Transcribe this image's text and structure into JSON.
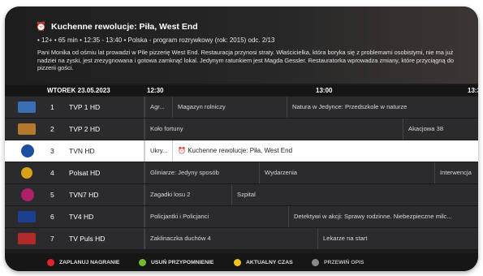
{
  "hero": {
    "clock_glyph": "⏰",
    "title": "Kuchenne rewolucje: Piła, West End",
    "meta": "•  12+  •  65 min  •  12:35 - 13:40  •  Polska - program rozrywkowy (rok: 2015) odc. 2/13",
    "description": "Pani Monika od ośmiu lat prowadzi w Pile pizzerię West End. Restauracja przynosi straty. Właścicielka, która boryka się z problemami osobistymi, nie ma już nadziei na zyski, jest zrezygnowana i gotowa zamknąć lokal. Jedynym ratunkiem jest Magda Gessler. Restauratorka wprowadza zmiany, które przyciągną do pizzerii gości."
  },
  "timebar": {
    "date": "WTOREK 23.05.2023",
    "t1": "12:30",
    "t2": "13:00",
    "t3": "13:3"
  },
  "channels": [
    {
      "num": "1",
      "name": "TVP 1 HD",
      "logo_color": "#3a6fb5",
      "programs": [
        "Agr...",
        "Magazyn rolniczy",
        "Natura w Jedynce: Przedszkole w naturze"
      ]
    },
    {
      "num": "2",
      "name": "TVP 2 HD",
      "logo_color": "#b4782e",
      "programs": [
        "Koło fortuny",
        "Akacjowa 38"
      ]
    },
    {
      "num": "3",
      "name": "TVN HD",
      "logo_color": "#1d4fa0",
      "programs": [
        "Ukry...",
        "Kuchenne rewolucje: Piła, West End"
      ]
    },
    {
      "num": "4",
      "name": "Polsat HD",
      "logo_color": "#d9a21a",
      "programs": [
        "Gliniarze: Jedyny sposób",
        "Wydarzenia",
        "Interwencja"
      ]
    },
    {
      "num": "5",
      "name": "TVN7 HD",
      "logo_color": "#b0206a",
      "programs": [
        "Zagadki losu 2",
        "Szpital"
      ]
    },
    {
      "num": "6",
      "name": "TV4 HD",
      "logo_color": "#1c3f8f",
      "programs": [
        "Policjantki i Policjanci",
        "Detektywi w akcji: Sprawy rodzinne. Niebezpieczne milc..."
      ]
    },
    {
      "num": "7",
      "name": "TV Puls HD",
      "logo_color": "#b02a2a",
      "programs": [
        "Zaklinaczka duchów 4",
        "Lekarze na start"
      ]
    }
  ],
  "footer": {
    "red_label": "ZAPLANUJ NAGRANIE",
    "red_color": "#e0242a",
    "green_label": "USUŃ PRZYPOMNIENIE",
    "green_color": "#6fbf2a",
    "yellow_label": "AKTUALNY CZAS",
    "yellow_color": "#f1c21b",
    "gray_label": "PRZEWIŃ OPIS",
    "gray_color": "#8a8a8a"
  }
}
